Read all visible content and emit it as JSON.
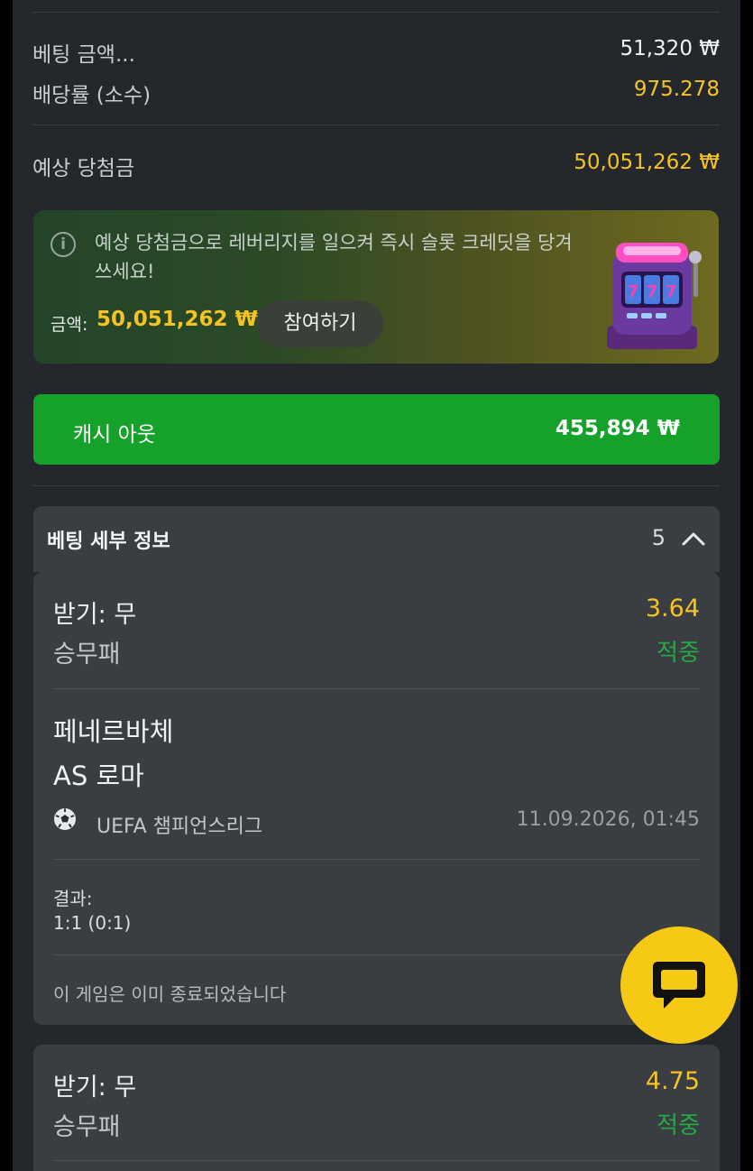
{
  "summary": {
    "stake_label": "베팅 금액...",
    "stake_value": "51,320 ₩",
    "odds_label": "배당률 (소수)",
    "odds_value": "975.278",
    "payout_label": "예상 당첨금",
    "payout_value": "50,051,262 ₩"
  },
  "promo": {
    "icon": "info-icon",
    "text": "예상 당첨금으로 레버리지를 일으켜 즉시 슬롯 크레딧을 당겨 쓰세요!",
    "amount_label": "금액:",
    "amount_value": "50,051,262 ₩",
    "join_label": "참여하기",
    "image": "slot-machine-illustration"
  },
  "cashout": {
    "label": "캐시 아웃",
    "value": "455,894 ₩",
    "color": "#16a12a"
  },
  "details": {
    "title": "베팅 세부 정보",
    "count": "5",
    "toggle_icon": "chevron-up-icon"
  },
  "bets": [
    {
      "pick": "받기: 무",
      "odds": "3.64",
      "market": "승무패",
      "status": "적중",
      "home": "페네르바체",
      "away": "AS 로마",
      "sport_icon": "soccer-ball-icon",
      "league": "UEFA 챔피언스리그",
      "datetime": "11.09.2026, 01:45",
      "result_label": "결과:",
      "result_value": "1:1 (0:1)",
      "note": "이 게임은 이미 종료되었습니다"
    },
    {
      "pick": "받기: 무",
      "odds": "4.75",
      "market": "승무패",
      "status": "적중"
    }
  ],
  "colors": {
    "accent_yellow": "#f6c324",
    "win_green": "#27a843",
    "panel_bg": "#24272b",
    "card_bg": "#3a3d42"
  },
  "chat_button_icon": "chat-bubble-icon"
}
